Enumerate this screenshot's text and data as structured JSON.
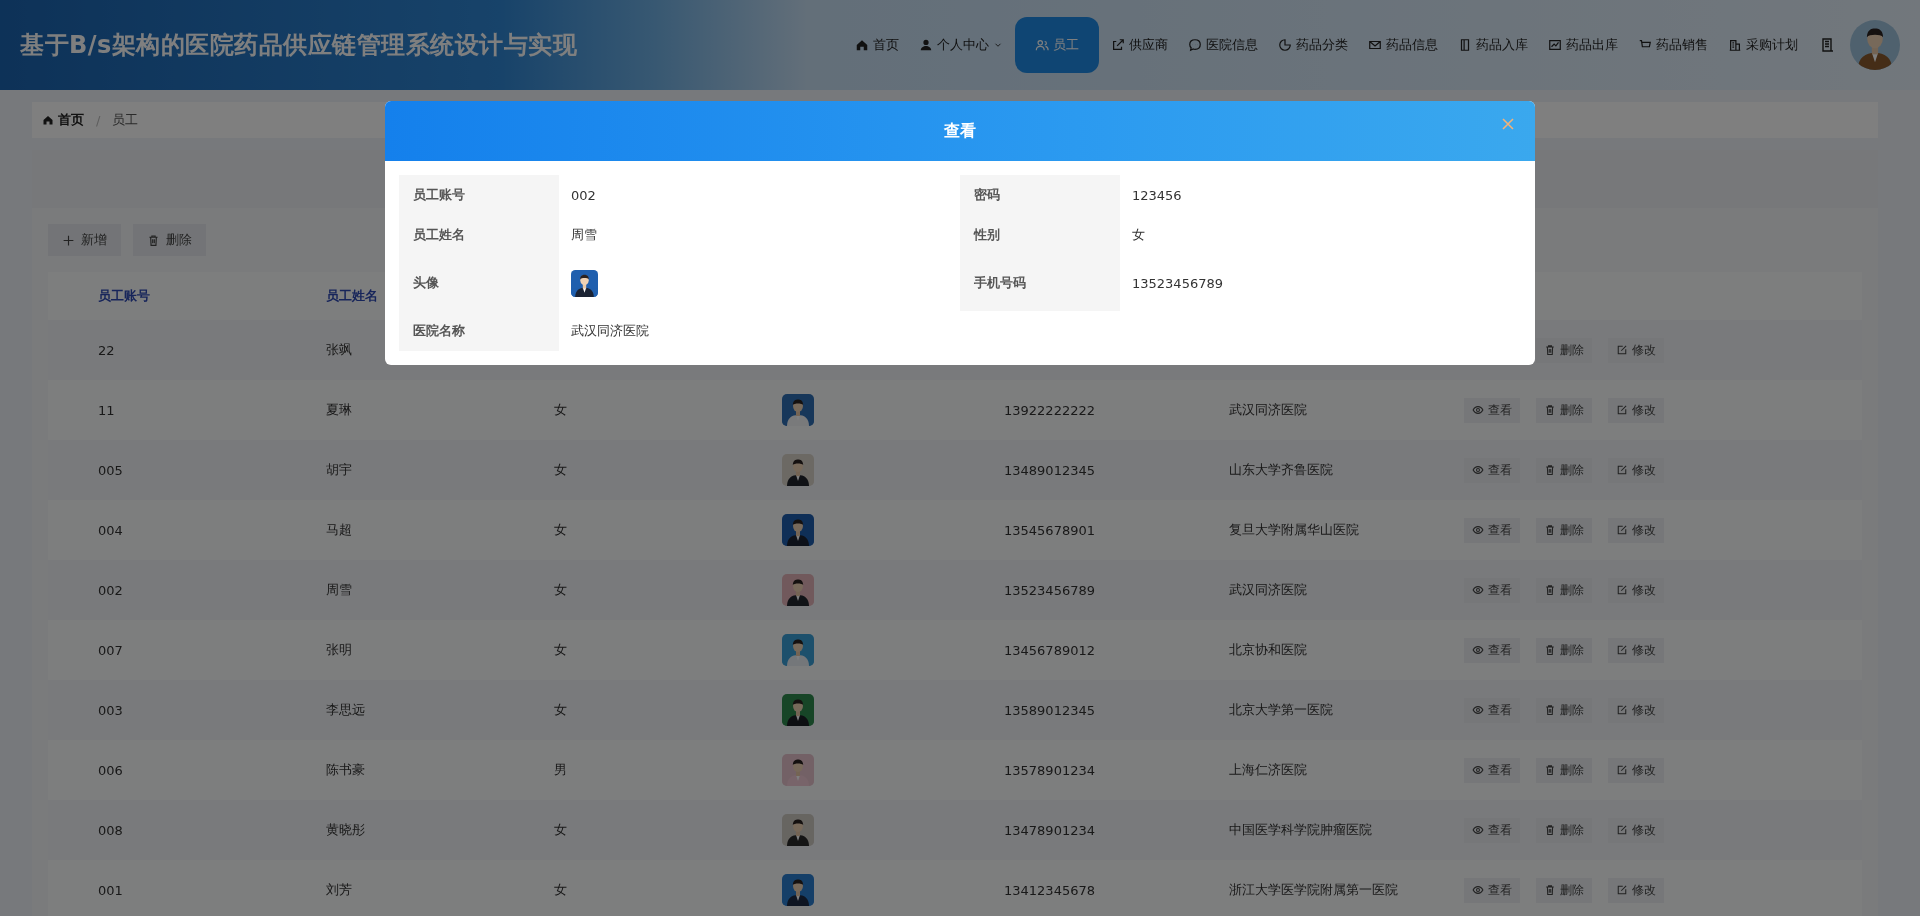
{
  "header": {
    "title": "基于B/s架构的医院药品供应链管理系统设计与实现",
    "nav": [
      {
        "label": "首页",
        "dropdown": false,
        "selected": false
      },
      {
        "label": "个人中心",
        "dropdown": true,
        "selected": false
      },
      {
        "label": "员工",
        "dropdown": false,
        "selected": true
      },
      {
        "label": "供应商",
        "dropdown": false,
        "selected": false
      },
      {
        "label": "医院信息",
        "dropdown": false,
        "selected": false
      },
      {
        "label": "药品分类",
        "dropdown": false,
        "selected": false
      },
      {
        "label": "药品信息",
        "dropdown": false,
        "selected": false
      },
      {
        "label": "药品入库",
        "dropdown": false,
        "selected": false
      },
      {
        "label": "药品出库",
        "dropdown": false,
        "selected": false
      },
      {
        "label": "药品销售",
        "dropdown": false,
        "selected": false
      },
      {
        "label": "采购计划",
        "dropdown": false,
        "selected": false
      }
    ]
  },
  "breadcrumb": {
    "separator": "/",
    "items": [
      "首页",
      "员工"
    ]
  },
  "toolbar": [
    {
      "kind": "add",
      "label": "新增"
    },
    {
      "kind": "delete",
      "label": "删除"
    }
  ],
  "table": {
    "columns": [
      "员工账号",
      "员工姓名"
    ],
    "rows": [
      {
        "account": "22",
        "name": "张飒",
        "actions": [
          {
            "kind": "delete",
            "label": "删除"
          },
          {
            "kind": "edit",
            "label": "修改"
          }
        ]
      },
      {
        "account": "11",
        "name": "夏琳",
        "gender": "女",
        "phone": "13922222222",
        "hospital": "武汉同济医院",
        "actions": [
          {
            "kind": "view",
            "label": "查看"
          },
          {
            "kind": "delete",
            "label": "删除"
          },
          {
            "kind": "edit",
            "label": "修改"
          }
        ]
      },
      {
        "account": "005",
        "name": "胡宇",
        "gender": "女",
        "phone": "13489012345",
        "hospital": "山东大学齐鲁医院",
        "actions": [
          {
            "kind": "view",
            "label": "查看"
          },
          {
            "kind": "delete",
            "label": "删除"
          },
          {
            "kind": "edit",
            "label": "修改"
          }
        ]
      },
      {
        "account": "004",
        "name": "马超",
        "gender": "女",
        "phone": "13545678901",
        "hospital": "复旦大学附属华山医院",
        "actions": [
          {
            "kind": "view",
            "label": "查看"
          },
          {
            "kind": "delete",
            "label": "删除"
          },
          {
            "kind": "edit",
            "label": "修改"
          }
        ]
      },
      {
        "account": "002",
        "name": "周雪",
        "gender": "女",
        "phone": "13523456789",
        "hospital": "武汉同济医院",
        "actions": [
          {
            "kind": "view",
            "label": "查看"
          },
          {
            "kind": "delete",
            "label": "删除"
          },
          {
            "kind": "edit",
            "label": "修改"
          }
        ]
      },
      {
        "account": "007",
        "name": "张明",
        "gender": "女",
        "phone": "13456789012",
        "hospital": "北京协和医院",
        "actions": [
          {
            "kind": "view",
            "label": "查看"
          },
          {
            "kind": "delete",
            "label": "删除"
          },
          {
            "kind": "edit",
            "label": "修改"
          }
        ]
      },
      {
        "account": "003",
        "name": "李思远",
        "gender": "女",
        "phone": "13589012345",
        "hospital": "北京大学第一医院",
        "actions": [
          {
            "kind": "view",
            "label": "查看"
          },
          {
            "kind": "delete",
            "label": "删除"
          },
          {
            "kind": "edit",
            "label": "修改"
          }
        ]
      },
      {
        "account": "006",
        "name": "陈书豪",
        "gender": "男",
        "phone": "13578901234",
        "hospital": "上海仁济医院",
        "actions": [
          {
            "kind": "view",
            "label": "查看"
          },
          {
            "kind": "delete",
            "label": "删除"
          },
          {
            "kind": "edit",
            "label": "修改"
          }
        ]
      },
      {
        "account": "008",
        "name": "黄晓彤",
        "gender": "女",
        "phone": "13478901234",
        "hospital": "中国医学科学院肿瘤医院",
        "actions": [
          {
            "kind": "view",
            "label": "查看"
          },
          {
            "kind": "delete",
            "label": "删除"
          },
          {
            "kind": "edit",
            "label": "修改"
          }
        ]
      },
      {
        "account": "001",
        "name": "刘芳",
        "gender": "女",
        "phone": "13412345678",
        "hospital": "浙江大学医学院附属第一医院",
        "actions": [
          {
            "kind": "view",
            "label": "查看"
          },
          {
            "kind": "delete",
            "label": "删除"
          },
          {
            "kind": "edit",
            "label": "修改"
          }
        ]
      }
    ]
  },
  "dialog": {
    "title": "查看",
    "fields": [
      {
        "label": "员工账号",
        "value": "002"
      },
      {
        "label": "密码",
        "value": "123456"
      },
      {
        "label": "员工姓名",
        "value": "周雪"
      },
      {
        "label": "性别",
        "value": "女"
      },
      {
        "label": "头像",
        "kind": "picture"
      },
      {
        "label": "手机号码",
        "value": "13523456789"
      },
      {
        "label": "医院名称",
        "value": "武汉同济医院"
      }
    ]
  }
}
